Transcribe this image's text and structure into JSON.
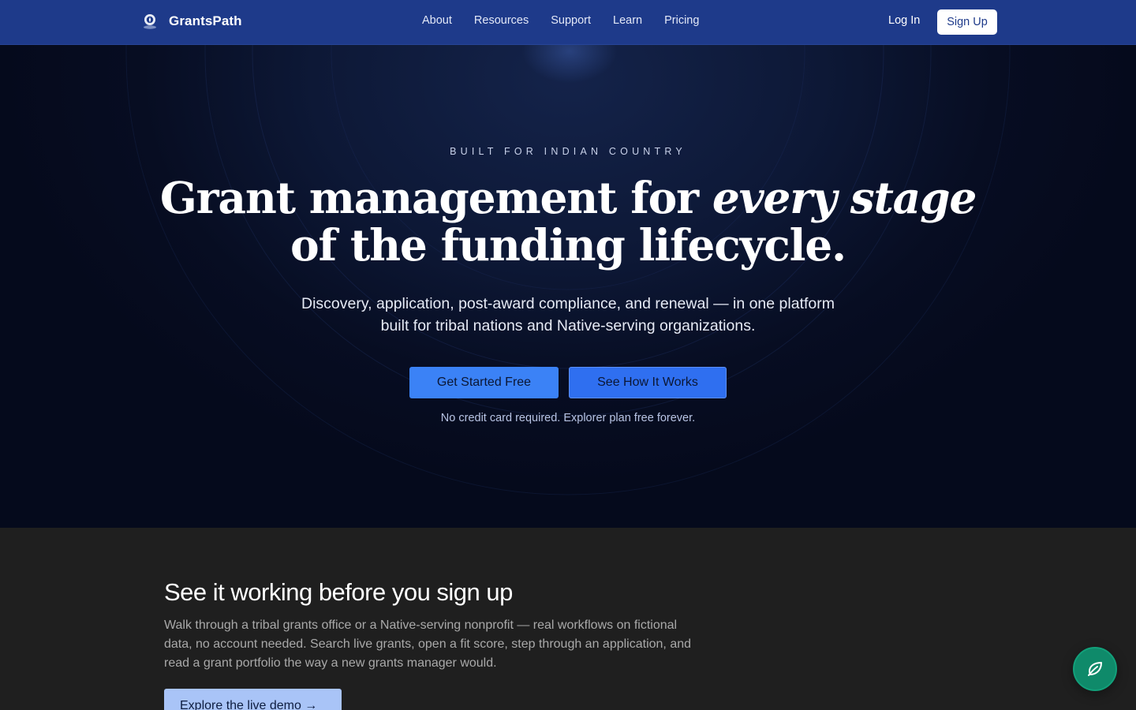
{
  "brand": {
    "name": "GrantsPath",
    "logo_icon": "compass-pin-icon"
  },
  "nav": {
    "links": [
      "About",
      "Resources",
      "Support",
      "Learn",
      "Pricing"
    ],
    "login": "Log In",
    "signup": "Sign Up"
  },
  "hero": {
    "eyebrow": "BUILT FOR INDIAN COUNTRY",
    "headline_line1_start": "Grant management for ",
    "headline_line1_em": "every stage",
    "headline_line2": "of the funding lifecycle.",
    "subhead_line1": "Discovery, application, post-award compliance, and renewal — in one platform",
    "subhead_line2": "built for tribal nations and Native-serving organizations.",
    "cta_primary": "Get Started Free",
    "cta_secondary": "See How It Works",
    "fineprint": "No credit card required. Explorer plan free forever."
  },
  "demo": {
    "title": "See it working before you sign up",
    "body": "Walk through a tribal grants office or a Native-serving nonprofit — real workflows on fictional data, no account needed. Search live grants, open a fit score, step through an application, and read a grant portfolio the way a new grants manager would.",
    "button": "Explore the live demo →"
  },
  "fab": {
    "icon": "leaf-icon"
  },
  "colors": {
    "nav_bg": "#1e3a8a",
    "hero_bg": "#070d22",
    "accent_blue": "#3b82f6",
    "section_bg": "#1f1f1f",
    "fab_green": "#0f8a6a"
  }
}
